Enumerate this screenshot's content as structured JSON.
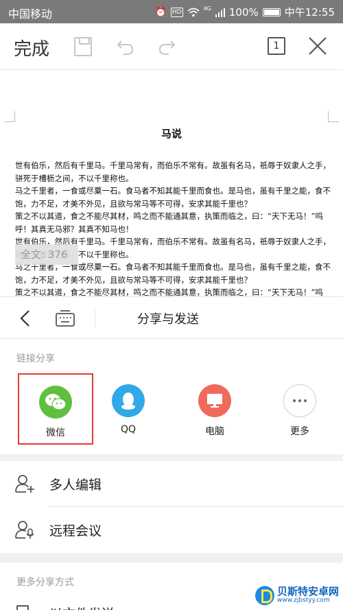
{
  "status_bar": {
    "carrier": "中国移动",
    "network": "4G",
    "battery": "100%",
    "time": "中午12:55",
    "icons": [
      "alarm-icon",
      "hd-icon",
      "wifi-icon",
      "signal-icon",
      "battery-icon"
    ]
  },
  "toolbar": {
    "done_label": "完成",
    "page_count": "1",
    "icons": [
      "save-icon",
      "undo-icon",
      "redo-icon",
      "pages-icon",
      "close-icon"
    ]
  },
  "document": {
    "title": "马说",
    "paragraphs": [
      "世有伯乐，然后有千里马。千里马常有，而伯乐不常有。故虽有名马，祇辱于奴隶人之手，骈死于槽枥之间，不以千里称也。",
      "马之千里者，一食或尽粟一石。食马者不知其能千里而食也。是马也，虽有千里之能，食不饱，力不足，才美不外见，且欲与常马等不可得，安求其能千里也？",
      "策之不以其道，食之不能尽其材，鸣之而不能通其意，执策而临之，曰：“天下无马！”呜呼！其真无马邪？其真不知马也！",
      "世有伯乐，然后有千里马。千里马常有，而伯乐不常有。故虽有名马，祇辱于奴隶人之手，骈死于槽枥之间，不以千里称也。",
      "马之千里者，一食或尽粟一石。食马者不知其能千里而食也。是马也，虽有千里之能，食不饱，力不足，才美不外见，且欲与常马等不可得，安求其能千里也？",
      "策之不以其道，食之不能尽其材，鸣之而不能通其意，执策而临之，曰：“天下无马！”呜呼！其真无马邪？其真不知马也！"
    ],
    "word_count": "全文: 376"
  },
  "share_sheet": {
    "title": "分享与发送",
    "link_section_label": "链接分享",
    "targets": [
      {
        "label": "微信",
        "icon": "wechat-icon",
        "color": "#5fbf3f",
        "selected": true
      },
      {
        "label": "QQ",
        "icon": "qq-icon",
        "color": "#2fa9e8"
      },
      {
        "label": "电脑",
        "icon": "computer-icon",
        "color": "#ef6a5a"
      },
      {
        "label": "更多",
        "icon": "more-icon",
        "color": "#ffffff"
      }
    ],
    "actions": [
      {
        "label": "多人编辑",
        "icon": "add-user-icon"
      },
      {
        "label": "远程会议",
        "icon": "meeting-icon"
      }
    ],
    "more_section_label": "更多分享方式",
    "partial_row_label": "以文件发送"
  },
  "watermark": {
    "name": "贝斯特安卓网",
    "url": "www.zjbstyy.com"
  },
  "colors": {
    "status_bar": "#7a7a7a",
    "highlight_border": "#e53935",
    "section_gap": "#f1f1f1"
  }
}
